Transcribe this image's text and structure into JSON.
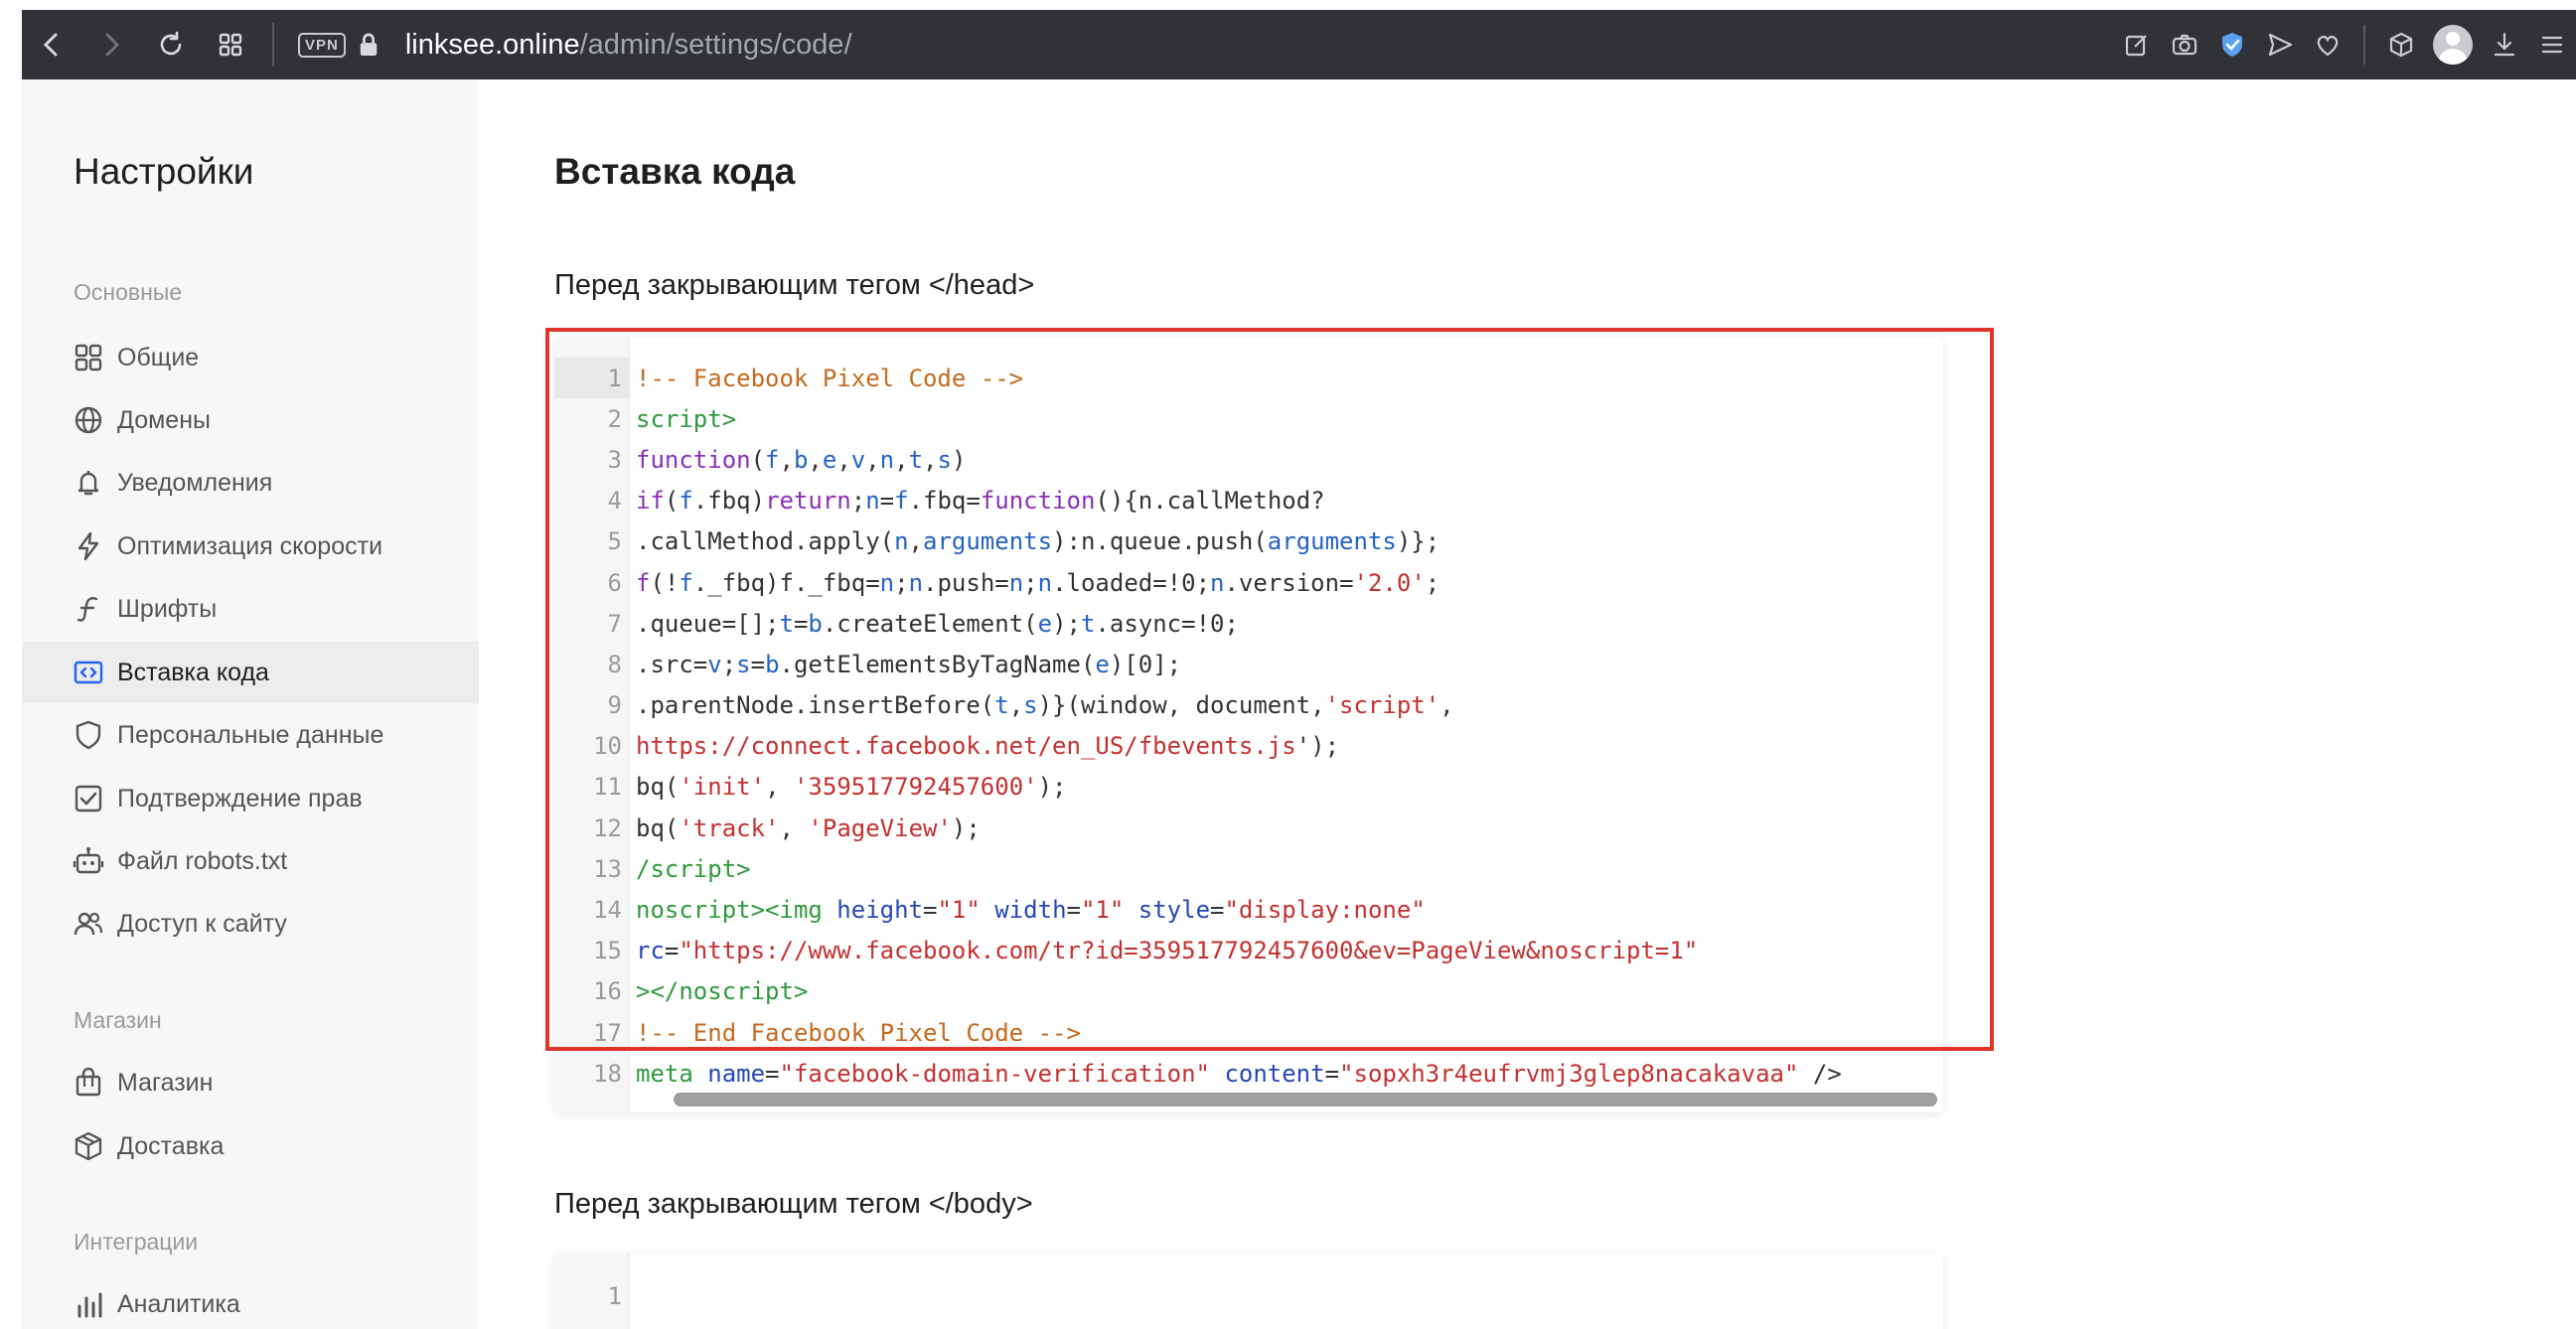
{
  "browser": {
    "vpn_label": "VPN",
    "url_host": "linksee.online",
    "url_path": "/admin/settings/code/"
  },
  "sidebar": {
    "title": "Настройки",
    "sections": [
      {
        "label": "Основные"
      },
      {
        "label": "Магазин"
      },
      {
        "label": "Интеграции"
      }
    ],
    "items": [
      {
        "label": "Общие",
        "icon": "grid-icon"
      },
      {
        "label": "Домены",
        "icon": "globe-icon"
      },
      {
        "label": "Уведомления",
        "icon": "bell-icon"
      },
      {
        "label": "Оптимизация скорости",
        "icon": "lightning-icon"
      },
      {
        "label": "Шрифты",
        "icon": "font-icon"
      },
      {
        "label": "Вставка кода",
        "icon": "code-icon",
        "active": true
      },
      {
        "label": "Персональные данные",
        "icon": "shield-icon"
      },
      {
        "label": "Подтверждение прав",
        "icon": "checkbox-icon"
      },
      {
        "label": "Файл robots.txt",
        "icon": "robot-icon"
      },
      {
        "label": "Доступ к сайту",
        "icon": "users-icon"
      },
      {
        "label": "Магазин",
        "icon": "shop-icon"
      },
      {
        "label": "Доставка",
        "icon": "box-icon"
      },
      {
        "label": "Аналитика",
        "icon": "bar-chart-icon"
      }
    ]
  },
  "main": {
    "title": "Вставка кода",
    "head_section_label": "Перед закрывающим тегом </head>",
    "body_section_label": "Перед закрывающим тегом </body>",
    "head_code_lines": [
      "!-- Facebook Pixel Code -->",
      "script>",
      "function(f,b,e,v,n,t,s)",
      "if(f.fbq)return;n=f.fbq=function(){n.callMethod?",
      ".callMethod.apply(n,arguments):n.queue.push(arguments)};",
      "f(!f._fbq)f._fbq=n;n.push=n;n.loaded=!0;n.version='2.0';",
      ".queue=[];t=b.createElement(e);t.async=!0;",
      ".src=v;s=b.getElementsByTagName(e)[0];",
      ".parentNode.insertBefore(t,s)}(window, document,'script',",
      "https://connect.facebook.net/en_US/fbevents.js');",
      "bq('init', '359517792457600');",
      "bq('track', 'PageView');",
      "/script>",
      "noscript><img height=\"1\" width=\"1\" style=\"display:none\"",
      "rc=\"https://www.facebook.com/tr?id=359517792457600&ev=PageView&noscript=1\"",
      "></noscript>",
      "!-- End Facebook Pixel Code -->",
      "meta name=\"facebook-domain-verification\" content=\"sopxh3r4eufrvmj3glep8nacakavaa\" />"
    ],
    "head_line_numbers": [
      "1",
      "2",
      "3",
      "4",
      "5",
      "6",
      "7",
      "8",
      "9",
      "10",
      "11",
      "12",
      "13",
      "14",
      "15",
      "16",
      "17",
      "18"
    ],
    "body_line_numbers": [
      "1"
    ]
  },
  "colors": {
    "highlight_border": "#e0342b",
    "toolbar_bg": "#303238",
    "sidebar_bg": "#f7f7f7",
    "active_item_bg": "#ececec",
    "accent_blue": "#2563eb"
  }
}
